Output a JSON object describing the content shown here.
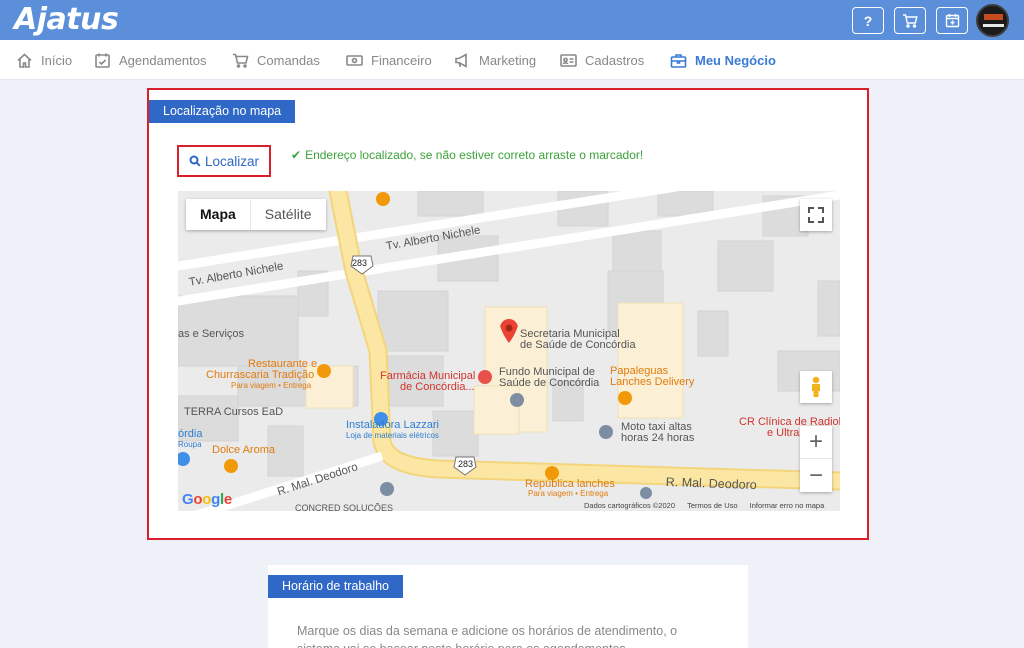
{
  "header": {
    "logo": "Ajatus",
    "buttons": [
      {
        "name": "help-button",
        "label": "?"
      },
      {
        "name": "cart-button",
        "icon": "cart-icon"
      },
      {
        "name": "calendar-add-button",
        "icon": "calendar-plus-icon"
      }
    ],
    "colors": {
      "bar": "#5b8fd9",
      "accent": "#2f68c6",
      "highlight": "#d9202c"
    }
  },
  "nav": {
    "items": [
      {
        "label": "Início",
        "icon": "home-icon"
      },
      {
        "label": "Agendamentos",
        "icon": "calendar-check-icon"
      },
      {
        "label": "Comandas",
        "icon": "cart-icon"
      },
      {
        "label": "Financeiro",
        "icon": "money-icon"
      },
      {
        "label": "Marketing",
        "icon": "megaphone-icon"
      },
      {
        "label": "Cadastros",
        "icon": "id-card-icon"
      },
      {
        "label": "Meu Negócio",
        "icon": "briefcase-icon",
        "active": true
      }
    ]
  },
  "location": {
    "tab_title": "Localização no mapa",
    "locate_button": "Localizar",
    "success_message": "Endereço localizado, se não estiver correto arraste o marcador!",
    "map": {
      "type_map": "Mapa",
      "type_satellite": "Satélite",
      "zoom_in": "+",
      "zoom_out": "−",
      "road_shield": "283",
      "streets": {
        "alberto_nichele": "Tv. Alberto Nichele",
        "mal_deodoro": "R. Mal. Deodoro"
      },
      "places": {
        "servicos": "as e Serviços",
        "restaurante_1": "Restaurante e",
        "restaurante_2": "Churrascaria Tradição",
        "restaurante_sub": "Para viagem • Entrega",
        "terra": "TERRA Cursos EaD",
        "roupa_1": "órdia",
        "roupa_2": "Roupa",
        "dolce": "Dolce Aroma",
        "instaladora_1": "Instaladora Lazzari",
        "instaladora_2": "Loja de materiais elétricos",
        "farmacia_1": "Farmácia Municipal",
        "farmacia_2": "de Concórdia...",
        "secretaria_1": "Secretaria Municipal",
        "secretaria_2": "de Saúde de Concórdia",
        "fundo_1": "Fundo Municipal de",
        "fundo_2": "Saúde de Concórdia",
        "papaleguas_1": "Papaleguas",
        "papaleguas_2": "Lanches Delivery",
        "moto_1": "Moto taxi altas",
        "moto_2": "horas 24 horas",
        "clinica_1": "CR Clínica de Radiolo",
        "clinica_2": "e Ultra",
        "republica_1": "República lanches",
        "republica_2": "Para viagem • Entrega",
        "concred": "CONCRED SOLUÇÕES"
      },
      "google": "Google",
      "footer": {
        "data": "Dados cartográficos ©2020",
        "terms": "Termos de Uso",
        "report": "Informar erro no mapa"
      }
    }
  },
  "schedule": {
    "tab_title": "Horário de trabalho",
    "description": "Marque os dias da semana e adicione os horários de atendimento, o sistema vai se basear neste horário para os agendamentos."
  }
}
